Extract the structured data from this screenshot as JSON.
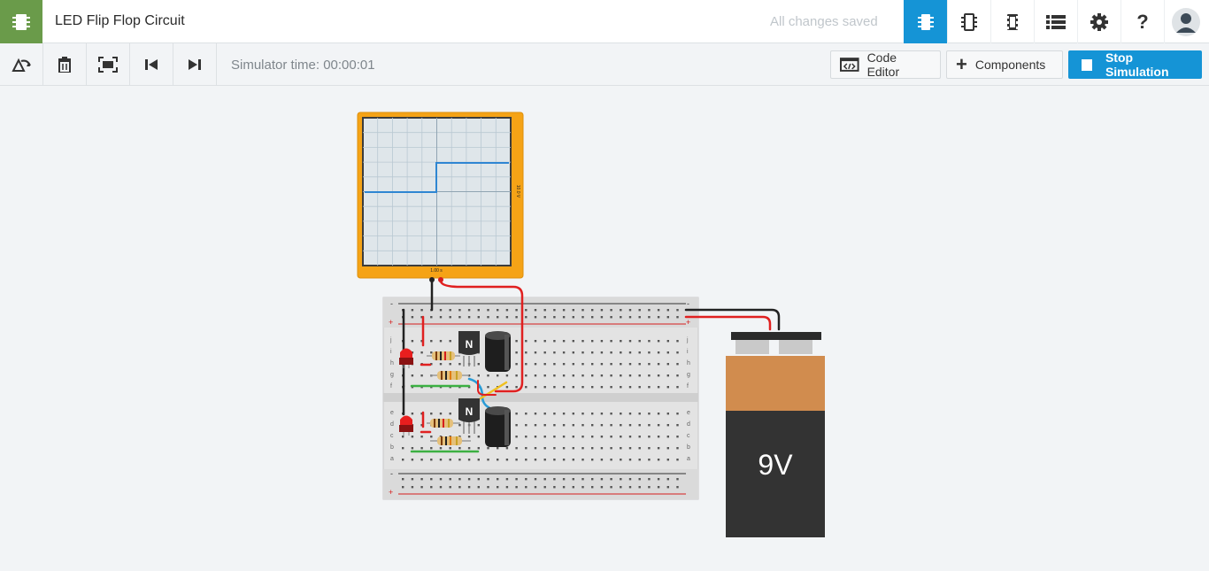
{
  "app": {
    "title": "LED Flip Flop Circuit",
    "save_status": "All changes saved"
  },
  "topbar": {
    "icons": [
      "circuit-view-icon",
      "schematic-view-icon",
      "component-list-icon",
      "list-icon",
      "settings-icon",
      "help-icon",
      "user-avatar-icon"
    ],
    "active": "circuit-view-icon"
  },
  "toolbar": {
    "sim_time": "Simulator time: 00:00:01",
    "code_editor_label": "Code Editor",
    "components_label": "Components",
    "stop_label": "Stop Simulation"
  },
  "oscilloscope": {
    "time_per_div": "1.00 s",
    "volts_per_div": "10.0 V"
  },
  "breadboard": {
    "rail_minus": "-",
    "rail_plus": "+",
    "row_labels_top": [
      "j",
      "i",
      "h",
      "g",
      "f"
    ],
    "row_labels_bottom": [
      "e",
      "d",
      "c",
      "b",
      "a"
    ]
  },
  "transistors": {
    "label": "N"
  },
  "battery": {
    "label": "9V"
  },
  "colors": {
    "accent": "#1594d6",
    "logo_green": "#6a9b4a",
    "scope_frame": "#f5a316",
    "wire_red": "#e02020",
    "wire_black": "#222222",
    "wire_green": "#3cb043",
    "wire_blue": "#2a9bd6",
    "wire_yellow": "#f0c020",
    "battery_top": "#d18c4e",
    "battery_body": "#333333"
  }
}
